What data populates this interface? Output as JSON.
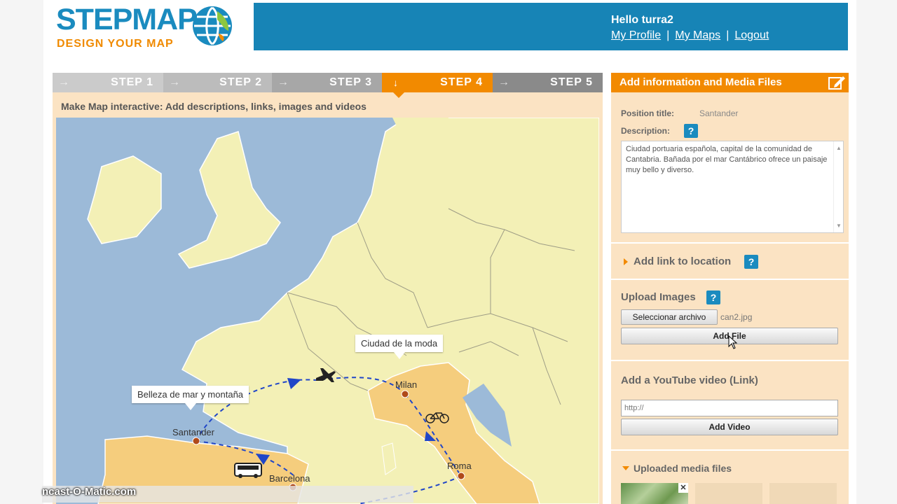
{
  "header": {
    "logo_main": "STEPMAP",
    "logo_sub": "DESIGN YOUR MAP",
    "greeting": "Hello turra2",
    "links": [
      "My Profile",
      "My Maps",
      "Logout"
    ],
    "separator": "|"
  },
  "steps": [
    {
      "label": "STEP 1",
      "state": "done"
    },
    {
      "label": "STEP 2",
      "state": "done"
    },
    {
      "label": "STEP 3",
      "state": "done"
    },
    {
      "label": "STEP 4",
      "state": "active"
    },
    {
      "label": "STEP 5",
      "state": "upcoming"
    }
  ],
  "main": {
    "subtitle": "Make Map interactive: Add descriptions, links, images and videos"
  },
  "map": {
    "bubbles": [
      "Ciudad de la moda",
      "Belleza de mar y montaña"
    ],
    "cities": [
      "Santander",
      "Milan",
      "Roma",
      "Barcelona"
    ],
    "route_icons": [
      "airplane-icon",
      "bicycle-icon",
      "bus-icon"
    ]
  },
  "panel": {
    "title": "Add information and Media Files",
    "position_title_label": "Position title:",
    "position_title_value": "Santander",
    "description_label": "Description:",
    "description_text": "Ciudad portuaria española, capital de la comunidad de Cantabria. Bañada por el mar Cantábrico ofrece un paisaje muy bello y diverso.",
    "add_link_label": "Add link to location",
    "upload_images_label": "Upload Images",
    "choose_file_label": "Seleccionar archivo",
    "chosen_file": "can2.jpg",
    "add_file_label": "Add File",
    "youtube_label": "Add a YouTube video (Link)",
    "youtube_value": "http://",
    "add_video_label": "Add Video",
    "uploaded_label": "Uploaded media files",
    "help_glyph": "?",
    "close_glyph": "✕"
  },
  "watermark": "ncast-O-Matic.com",
  "colors": {
    "brand_blue": "#1784b6",
    "accent_orange": "#f28a00",
    "panel_bg": "#fbe3c3"
  }
}
